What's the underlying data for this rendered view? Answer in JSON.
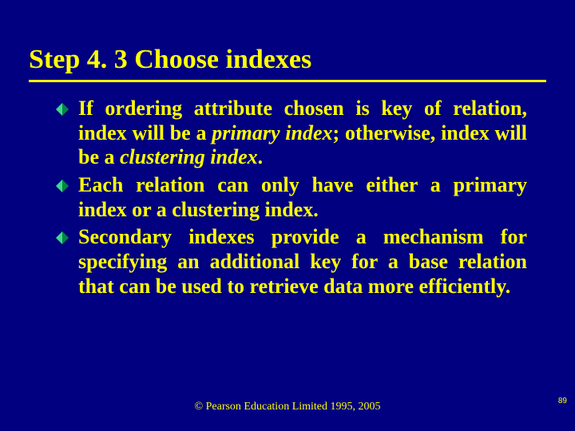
{
  "title": "Step 4. 3  Choose indexes",
  "bullets": [
    {
      "parts": [
        {
          "text": "If ordering attribute chosen is key of relation, index will be a ",
          "italic": false
        },
        {
          "text": "primary index",
          "italic": true
        },
        {
          "text": "; otherwise, index will be a ",
          "italic": false
        },
        {
          "text": "clustering index",
          "italic": true
        },
        {
          "text": ".",
          "italic": false
        }
      ]
    },
    {
      "parts": [
        {
          "text": "Each relation can only have either a primary index or a clustering index.",
          "italic": false
        }
      ]
    },
    {
      "parts": [
        {
          "text": "Secondary indexes provide a mechanism for specifying an additional key for a base relation that can be used to retrieve data more efficiently.",
          "italic": false
        }
      ]
    }
  ],
  "footer": "© Pearson Education Limited 1995, 2005",
  "page_number": "89",
  "colors": {
    "background": "#000080",
    "text": "#ffff00",
    "bullet_fill": "#00cc66"
  },
  "icons": {
    "bullet": "diamond-bullet-icon"
  }
}
